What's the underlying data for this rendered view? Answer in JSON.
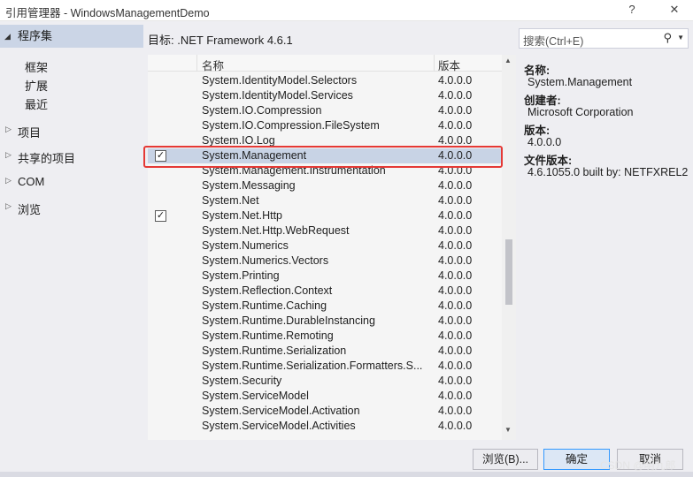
{
  "window": {
    "title": "引用管理器 - WindowsManagementDemo",
    "help_label": "?",
    "close_label": "✕"
  },
  "sidebar": {
    "selected": {
      "label": "程序集"
    },
    "sub_items": [
      {
        "label": "框架"
      },
      {
        "label": "扩展"
      },
      {
        "label": "最近"
      }
    ],
    "groups": [
      {
        "label": "项目"
      },
      {
        "label": "共享的项目"
      },
      {
        "label": "COM"
      },
      {
        "label": "浏览"
      }
    ]
  },
  "target": {
    "label": "目标: .NET Framework 4.6.1"
  },
  "search": {
    "placeholder": "搜索(Ctrl+E)",
    "icon": "search-icon"
  },
  "list": {
    "columns": {
      "name": "名称",
      "version": "版本"
    },
    "rows": [
      {
        "name": "System.IdentityModel.Selectors",
        "version": "4.0.0.0",
        "checked": false,
        "selected": false
      },
      {
        "name": "System.IdentityModel.Services",
        "version": "4.0.0.0",
        "checked": false,
        "selected": false
      },
      {
        "name": "System.IO.Compression",
        "version": "4.0.0.0",
        "checked": false,
        "selected": false
      },
      {
        "name": "System.IO.Compression.FileSystem",
        "version": "4.0.0.0",
        "checked": false,
        "selected": false
      },
      {
        "name": "System.IO.Log",
        "version": "4.0.0.0",
        "checked": false,
        "selected": false
      },
      {
        "name": "System.Management",
        "version": "4.0.0.0",
        "checked": true,
        "selected": true
      },
      {
        "name": "System.Management.Instrumentation",
        "version": "4.0.0.0",
        "checked": false,
        "selected": false
      },
      {
        "name": "System.Messaging",
        "version": "4.0.0.0",
        "checked": false,
        "selected": false
      },
      {
        "name": "System.Net",
        "version": "4.0.0.0",
        "checked": false,
        "selected": false
      },
      {
        "name": "System.Net.Http",
        "version": "4.0.0.0",
        "checked": true,
        "selected": false
      },
      {
        "name": "System.Net.Http.WebRequest",
        "version": "4.0.0.0",
        "checked": false,
        "selected": false
      },
      {
        "name": "System.Numerics",
        "version": "4.0.0.0",
        "checked": false,
        "selected": false
      },
      {
        "name": "System.Numerics.Vectors",
        "version": "4.0.0.0",
        "checked": false,
        "selected": false
      },
      {
        "name": "System.Printing",
        "version": "4.0.0.0",
        "checked": false,
        "selected": false
      },
      {
        "name": "System.Reflection.Context",
        "version": "4.0.0.0",
        "checked": false,
        "selected": false
      },
      {
        "name": "System.Runtime.Caching",
        "version": "4.0.0.0",
        "checked": false,
        "selected": false
      },
      {
        "name": "System.Runtime.DurableInstancing",
        "version": "4.0.0.0",
        "checked": false,
        "selected": false
      },
      {
        "name": "System.Runtime.Remoting",
        "version": "4.0.0.0",
        "checked": false,
        "selected": false
      },
      {
        "name": "System.Runtime.Serialization",
        "version": "4.0.0.0",
        "checked": false,
        "selected": false
      },
      {
        "name": "System.Runtime.Serialization.Formatters.S...",
        "version": "4.0.0.0",
        "checked": false,
        "selected": false
      },
      {
        "name": "System.Security",
        "version": "4.0.0.0",
        "checked": false,
        "selected": false
      },
      {
        "name": "System.ServiceModel",
        "version": "4.0.0.0",
        "checked": false,
        "selected": false
      },
      {
        "name": "System.ServiceModel.Activation",
        "version": "4.0.0.0",
        "checked": false,
        "selected": false
      },
      {
        "name": "System.ServiceModel.Activities",
        "version": "4.0.0.0",
        "checked": false,
        "selected": false
      }
    ]
  },
  "details": {
    "name_label": "名称:",
    "name_value": "System.Management",
    "creator_label": "创建者:",
    "creator_value": "Microsoft Corporation",
    "version_label": "版本:",
    "version_value": "4.0.0.0",
    "file_version_label": "文件版本:",
    "file_version_value": "4.6.1055.0 built by: NETFXREL2"
  },
  "buttons": {
    "browse": "浏览(B)...",
    "ok": "确定",
    "cancel": "取消"
  },
  "watermark": "CSDN @明九郎",
  "colors": {
    "selection": "#c8d3e5",
    "highlight_border": "#e53935",
    "primary_border": "#3399ff"
  }
}
